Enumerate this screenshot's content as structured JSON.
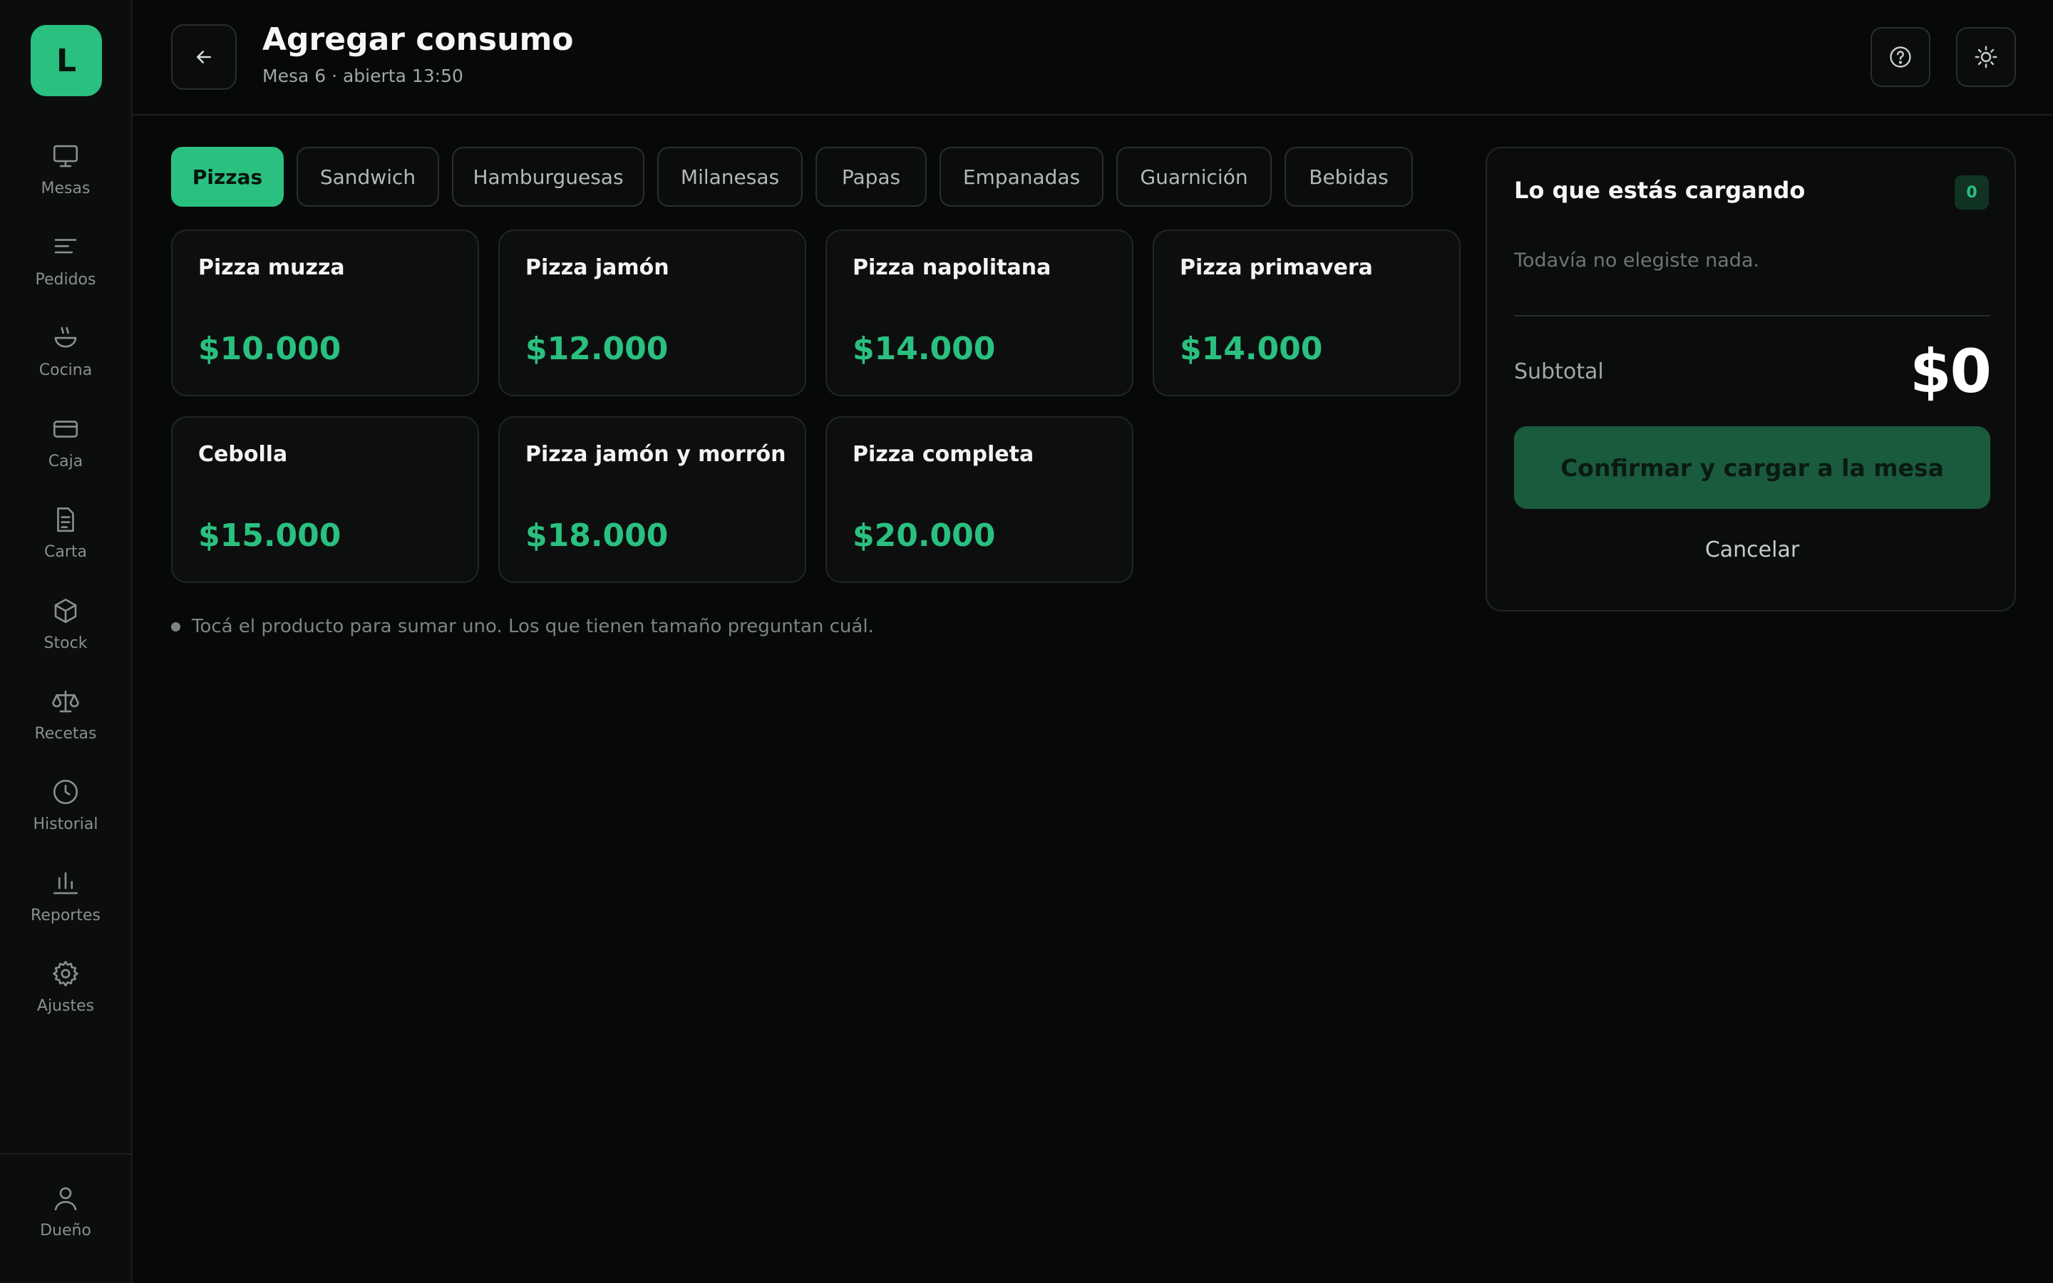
{
  "app": {
    "logo_letter": "L",
    "accent_color": "#2ac07f"
  },
  "sidebar": {
    "items": [
      {
        "label": "Mesas",
        "icon": "monitor-icon"
      },
      {
        "label": "Pedidos",
        "icon": "lines-icon"
      },
      {
        "label": "Cocina",
        "icon": "bowl-icon"
      },
      {
        "label": "Caja",
        "icon": "credit-card-icon"
      },
      {
        "label": "Carta",
        "icon": "document-icon"
      },
      {
        "label": "Stock",
        "icon": "box-icon"
      },
      {
        "label": "Recetas",
        "icon": "scale-icon"
      },
      {
        "label": "Historial",
        "icon": "clock-icon"
      },
      {
        "label": "Reportes",
        "icon": "bar-chart-icon"
      },
      {
        "label": "Ajustes",
        "icon": "gear-icon"
      }
    ],
    "user": {
      "label": "Dueño",
      "icon": "user-icon"
    }
  },
  "header": {
    "title": "Agregar consumo",
    "subtitle": "Mesa 6 · abierta 13:50",
    "back_icon": "arrow-left-icon",
    "help_icon": "help-circle-icon",
    "theme_icon": "sun-icon"
  },
  "categories": {
    "tabs": [
      "Pizzas",
      "Sandwich",
      "Hamburguesas",
      "Milanesas",
      "Papas",
      "Empanadas",
      "Guarnición",
      "Bebidas"
    ],
    "active": "Pizzas"
  },
  "products": [
    {
      "name": "Pizza muzza",
      "price": "$10.000"
    },
    {
      "name": "Pizza jamón",
      "price": "$12.000"
    },
    {
      "name": "Pizza napolitana",
      "price": "$14.000"
    },
    {
      "name": "Pizza primavera",
      "price": "$14.000"
    },
    {
      "name": "Cebolla",
      "price": "$15.000"
    },
    {
      "name": "Pizza jamón y morrón",
      "price": "$18.000"
    },
    {
      "name": "Pizza completa",
      "price": "$20.000"
    }
  ],
  "hint": "Tocá el producto para sumar uno. Los que tienen tamaño preguntan cuál.",
  "cart": {
    "title": "Lo que estás cargando",
    "count": "0",
    "empty_text": "Todavía no elegiste nada.",
    "subtotal_label": "Subtotal",
    "subtotal_value": "$0",
    "confirm_label": "Confirmar y cargar a la mesa",
    "cancel_label": "Cancelar"
  }
}
